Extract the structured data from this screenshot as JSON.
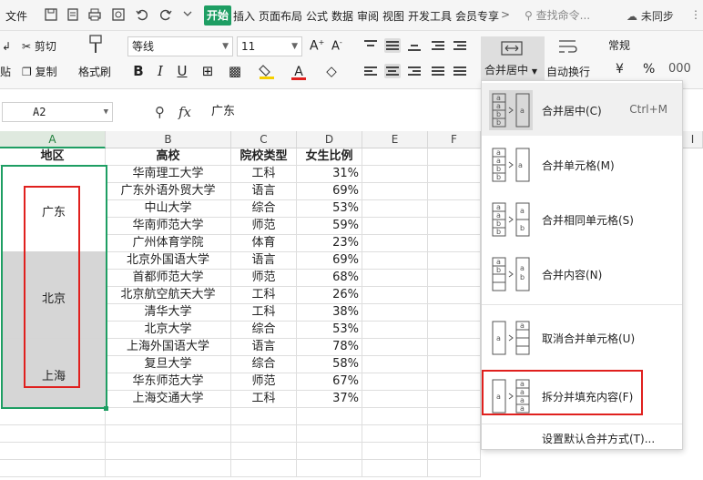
{
  "menubar": {
    "file": "文件",
    "tabs": [
      "开始",
      "插入",
      "页面布局",
      "公式",
      "数据",
      "审阅",
      "视图",
      "开发工具",
      "会员专享"
    ],
    "search_placeholder": "查找命令...",
    "sync": "未同步"
  },
  "ribbon": {
    "cut": "剪切",
    "paste_short": "贴",
    "copy": "复制",
    "format_painter": "格式刷",
    "font_name": "等线",
    "font_size": "11",
    "merge_center": "合并居中",
    "wrap_text": "自动换行",
    "number_format": "常规",
    "currency": "¥",
    "percent": "%",
    "bold": "B",
    "italic": "I",
    "underline": "U",
    "font_color": "A"
  },
  "formula_bar": {
    "cell_ref": "A2",
    "fx": "fx",
    "content": "广东"
  },
  "grid": {
    "columns": [
      "A",
      "B",
      "C",
      "D",
      "E",
      "F",
      "I"
    ],
    "headers": [
      "地区",
      "高校",
      "院校类型",
      "女生比例"
    ],
    "regions": [
      "广东",
      "北京",
      "上海"
    ],
    "rows": [
      [
        "华南理工大学",
        "工科",
        "31%"
      ],
      [
        "广东外语外贸大学",
        "语言",
        "69%"
      ],
      [
        "中山大学",
        "综合",
        "53%"
      ],
      [
        "华南师范大学",
        "师范",
        "59%"
      ],
      [
        "广州体育学院",
        "体育",
        "23%"
      ],
      [
        "北京外国语大学",
        "语言",
        "69%"
      ],
      [
        "首都师范大学",
        "师范",
        "68%"
      ],
      [
        "北京航空航天大学",
        "工科",
        "26%"
      ],
      [
        "清华大学",
        "工科",
        "38%"
      ],
      [
        "北京大学",
        "综合",
        "53%"
      ],
      [
        "上海外国语大学",
        "语言",
        "78%"
      ],
      [
        "复旦大学",
        "综合",
        "58%"
      ],
      [
        "华东师范大学",
        "师范",
        "67%"
      ],
      [
        "上海交通大学",
        "工科",
        "37%"
      ]
    ]
  },
  "dropdown": {
    "items": [
      {
        "label": "合并居中(C)",
        "shortcut": "Ctrl+M"
      },
      {
        "label": "合并单元格(M)"
      },
      {
        "label": "合并相同单元格(S)"
      },
      {
        "label": "合并内容(N)"
      },
      {
        "label": "取消合并单元格(U)"
      },
      {
        "label": "拆分并填充内容(F)"
      },
      {
        "label": "设置默认合并方式(T)..."
      }
    ]
  },
  "colors": {
    "accent_green": "#1e9e63",
    "highlight_red": "#e0201e",
    "merged_gray": "#d6d6d6"
  }
}
